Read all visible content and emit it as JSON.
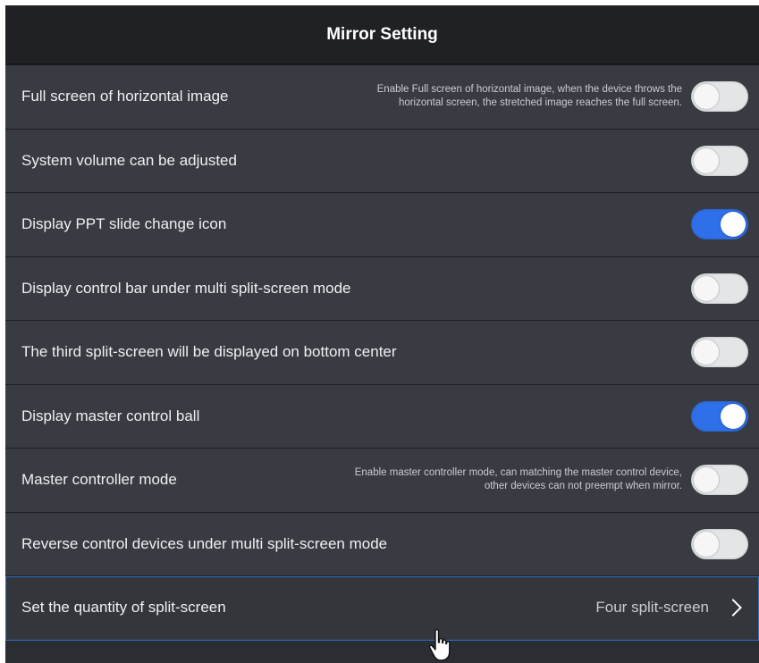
{
  "header": {
    "title": "Mirror Setting"
  },
  "rows": [
    {
      "label": "Full screen of horizontal image",
      "desc_line1": "Enable Full screen of horizontal image, when the device throws the",
      "desc_line2": "horizontal screen, the stretched image reaches the full screen.",
      "toggle": "off"
    },
    {
      "label": "System volume can be adjusted",
      "toggle": "off"
    },
    {
      "label": "Display PPT slide change icon",
      "toggle": "on"
    },
    {
      "label": "Display control bar under multi split-screen mode",
      "toggle": "off"
    },
    {
      "label": "The third split-screen will be displayed on bottom center",
      "toggle": "off"
    },
    {
      "label": "Display master control ball",
      "toggle": "on"
    },
    {
      "label": "Master controller mode",
      "desc_line1": "Enable master controller mode, can matching the master control device,",
      "desc_line2": "other devices can not preempt when mirror.",
      "toggle": "off"
    },
    {
      "label": "Reverse control devices under multi split-screen mode",
      "toggle": "off"
    },
    {
      "label": "Set the quantity of split-screen",
      "value": "Four split-screen"
    }
  ],
  "colors": {
    "accent": "#2f6fe8",
    "panel": "#383b41",
    "header": "#1f2125",
    "selection_border": "#2c6fc2"
  },
  "icons": {
    "chevron": "chevron-right-icon",
    "cursor": "hand-pointer-icon"
  }
}
